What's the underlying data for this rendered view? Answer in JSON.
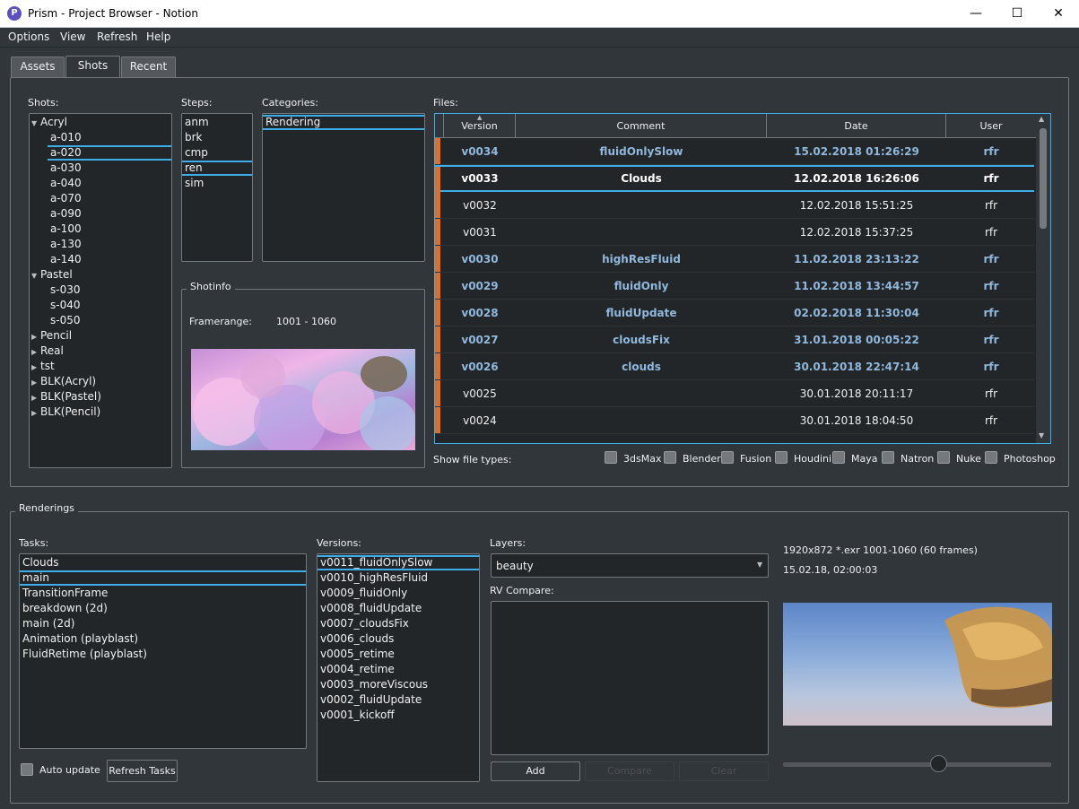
{
  "window": {
    "title": "Prism - Project Browser - Notion",
    "app_icon": "P"
  },
  "window_controls": {
    "minimize": "—",
    "maximize": "☐",
    "close": "✕"
  },
  "menu": [
    "Options",
    "View",
    "Refresh",
    "Help"
  ],
  "tabs": [
    "Assets",
    "Shots",
    "Recent"
  ],
  "shots_label": "Shots:",
  "shots_tree": [
    {
      "label": "Acryl",
      "expanded": true,
      "level": 0
    },
    {
      "label": "a-010",
      "level": 1
    },
    {
      "label": "a-020",
      "level": 1,
      "selected": true
    },
    {
      "label": "a-030",
      "level": 1
    },
    {
      "label": "a-040",
      "level": 1
    },
    {
      "label": "a-070",
      "level": 1
    },
    {
      "label": "a-090",
      "level": 1
    },
    {
      "label": "a-100",
      "level": 1
    },
    {
      "label": "a-130",
      "level": 1
    },
    {
      "label": "a-140",
      "level": 1
    },
    {
      "label": "Pastel",
      "expanded": true,
      "level": 0
    },
    {
      "label": "s-030",
      "level": 1
    },
    {
      "label": "s-040",
      "level": 1
    },
    {
      "label": "s-050",
      "level": 1
    },
    {
      "label": "Pencil",
      "expanded": false,
      "level": 0
    },
    {
      "label": "Real",
      "expanded": false,
      "level": 0
    },
    {
      "label": "tst",
      "expanded": false,
      "level": 0
    },
    {
      "label": "BLK(Acryl)",
      "expanded": false,
      "level": 0
    },
    {
      "label": "BLK(Pastel)",
      "expanded": false,
      "level": 0
    },
    {
      "label": "BLK(Pencil)",
      "expanded": false,
      "level": 0
    }
  ],
  "steps_label": "Steps:",
  "steps": [
    {
      "label": "anm"
    },
    {
      "label": "brk"
    },
    {
      "label": "cmp"
    },
    {
      "label": "ren",
      "selected": true
    },
    {
      "label": "sim"
    }
  ],
  "categories_label": "Categories:",
  "categories": [
    {
      "label": "Rendering",
      "selected": true
    }
  ],
  "shotinfo": {
    "title": "Shotinfo",
    "framerange_label": "Framerange:",
    "framerange_value": "1001 - 1060"
  },
  "files_label": "Files:",
  "files_columns": [
    "Version",
    "Comment",
    "Date",
    "User"
  ],
  "files": [
    {
      "version": "v0034",
      "comment": "fluidOnlySlow",
      "date": "15.02.2018 01:26:29",
      "user": "rfr",
      "bold": true,
      "marker": true
    },
    {
      "version": "v0033",
      "comment": "Clouds",
      "date": "12.02.2018 16:26:06",
      "user": "rfr",
      "bold": true,
      "marker": true,
      "selected": true
    },
    {
      "version": "v0032",
      "comment": "",
      "date": "12.02.2018 15:51:25",
      "user": "rfr",
      "marker": true
    },
    {
      "version": "v0031",
      "comment": "",
      "date": "12.02.2018 15:37:25",
      "user": "rfr",
      "marker": true
    },
    {
      "version": "v0030",
      "comment": "highResFluid",
      "date": "11.02.2018 23:13:22",
      "user": "rfr",
      "bold": true,
      "marker": true
    },
    {
      "version": "v0029",
      "comment": "fluidOnly",
      "date": "11.02.2018 13:44:57",
      "user": "rfr",
      "bold": true,
      "marker": true
    },
    {
      "version": "v0028",
      "comment": "fluidUpdate",
      "date": "02.02.2018 11:30:04",
      "user": "rfr",
      "bold": true,
      "marker": true
    },
    {
      "version": "v0027",
      "comment": "cloudsFix",
      "date": "31.01.2018 00:05:22",
      "user": "rfr",
      "bold": true,
      "marker": true
    },
    {
      "version": "v0026",
      "comment": "clouds",
      "date": "30.01.2018 22:47:14",
      "user": "rfr",
      "bold": true,
      "marker": true
    },
    {
      "version": "v0025",
      "comment": "",
      "date": "30.01.2018 20:11:17",
      "user": "rfr",
      "marker": true
    },
    {
      "version": "v0024",
      "comment": "",
      "date": "30.01.2018 18:04:50",
      "user": "rfr",
      "marker": true
    }
  ],
  "show_file_types_label": "Show file types:",
  "file_types": [
    "3dsMax",
    "Blender",
    "Fusion",
    "Houdini",
    "Maya",
    "Natron",
    "Nuke",
    "Photoshop"
  ],
  "renderings": {
    "title": "Renderings",
    "tasks_label": "Tasks:",
    "tasks": [
      {
        "label": "Clouds"
      },
      {
        "label": "main",
        "selected": true
      },
      {
        "label": "TransitionFrame"
      },
      {
        "label": "breakdown (2d)"
      },
      {
        "label": "main (2d)"
      },
      {
        "label": "Animation (playblast)"
      },
      {
        "label": "FluidRetime (playblast)"
      }
    ],
    "versions_label": "Versions:",
    "versions": [
      {
        "label": "v0011_fluidOnlySlow",
        "selected": true
      },
      {
        "label": "v0010_highResFluid"
      },
      {
        "label": "v0009_fluidOnly"
      },
      {
        "label": "v0008_fluidUpdate"
      },
      {
        "label": "v0007_cloudsFix"
      },
      {
        "label": "v0006_clouds"
      },
      {
        "label": "v0005_retime"
      },
      {
        "label": "v0004_retime"
      },
      {
        "label": "v0003_moreViscous"
      },
      {
        "label": "v0002_fluidUpdate"
      },
      {
        "label": "v0001_kickoff"
      }
    ],
    "layers_label": "Layers:",
    "layer_selected": "beauty",
    "rv_compare_label": "RV Compare:",
    "add_button": "Add",
    "compare_button": "Compare",
    "clear_button": "Clear",
    "auto_update_label": "Auto update",
    "refresh_tasks_button": "Refresh Tasks",
    "info_line1": "1920x872   *.exr   1001-1060 (60 frames)",
    "info_line2": "15.02.18,  02:00:03",
    "slider_position": 0.58
  },
  "colors": {
    "accent": "#3daee9",
    "marker": "#e06d2a",
    "background": "#31363b",
    "list_bg": "#232629"
  }
}
